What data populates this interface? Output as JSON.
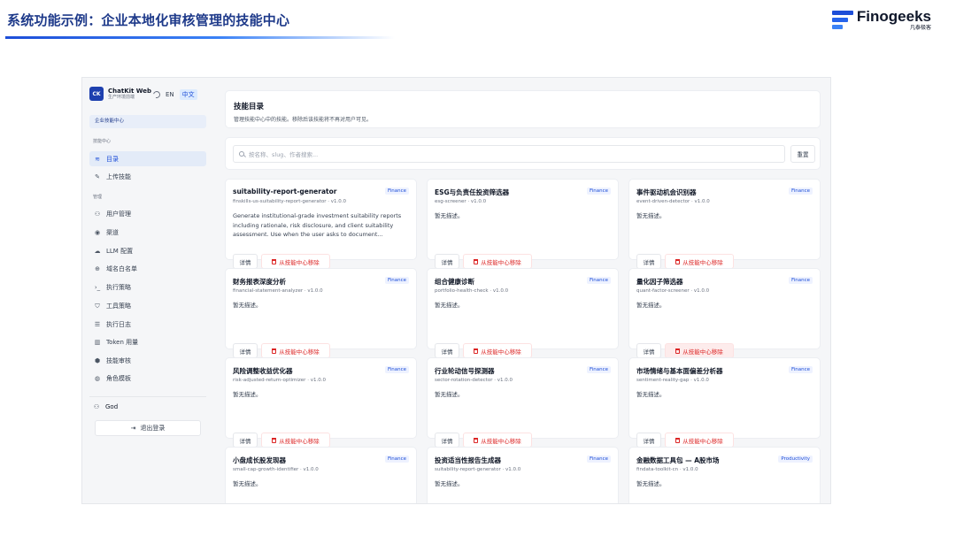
{
  "slide": {
    "title": "系统功能示例：企业本地化审核管理的技能中心",
    "brand": {
      "name": "Finogeeks",
      "sub": "凡泰极客"
    }
  },
  "sidebar": {
    "app_name": "ChatKit Web",
    "app_sub": "生产环境前端",
    "lang_en": "EN",
    "lang_zh": "中文",
    "enterprise_chip": "企业技能中心",
    "section_skills": "技能中心",
    "section_manage": "管理",
    "skills_items": [
      {
        "label": "目录",
        "icon": "layers-icon",
        "glyph": "≋"
      },
      {
        "label": "上传技能",
        "icon": "edit-icon",
        "glyph": "✎"
      }
    ],
    "manage_items": [
      {
        "label": "用户管理",
        "icon": "users-icon",
        "glyph": "⚇"
      },
      {
        "label": "渠道",
        "icon": "radio-icon",
        "glyph": "◉"
      },
      {
        "label": "LLM 配置",
        "icon": "cloud-icon",
        "glyph": "☁"
      },
      {
        "label": "域名白名单",
        "icon": "globe-icon",
        "glyph": "⊕"
      },
      {
        "label": "执行策略",
        "icon": "terminal-icon",
        "glyph": "›_"
      },
      {
        "label": "工具策略",
        "icon": "shield-icon",
        "glyph": "⛉"
      },
      {
        "label": "执行日志",
        "icon": "list-icon",
        "glyph": "☰"
      },
      {
        "label": "Token 用量",
        "icon": "bar-chart-icon",
        "glyph": "▥"
      },
      {
        "label": "技能审核",
        "icon": "package-icon",
        "glyph": "⬢"
      },
      {
        "label": "角色模板",
        "icon": "palette-icon",
        "glyph": "◍"
      }
    ],
    "user": "God",
    "logout": "退出登录"
  },
  "main": {
    "title": "技能目录",
    "description": "管理技能中心中的技能。移除后该技能将不再对用户可见。",
    "search_placeholder": "按名称、slug、作者搜索...",
    "reset": "重置",
    "detail_label": "详情",
    "remove_label": "从技能中心移除",
    "skills": [
      {
        "name": "suitability-report-generator",
        "tag": "Finance",
        "slug": "finskills-us-suitability-report-generator · v1.0.0",
        "desc": "Generate institutional-grade investment suitability reports including rationale, risk disclosure, and client suitability assessment. Use when the user asks to document..."
      },
      {
        "name": "ESG与负责任投资筛选器",
        "tag": "Finance",
        "slug": "esg-screener · v1.0.0",
        "desc": "暂无描述。"
      },
      {
        "name": "事件驱动机会识别器",
        "tag": "Finance",
        "slug": "event-driven-detector · v1.0.0",
        "desc": "暂无描述。"
      },
      {
        "name": "财务报表深度分析",
        "tag": "Finance",
        "slug": "financial-statement-analyzer · v1.0.0",
        "desc": "暂无描述。"
      },
      {
        "name": "组合健康诊断",
        "tag": "Finance",
        "slug": "portfolio-health-check · v1.0.0",
        "desc": "暂无描述。"
      },
      {
        "name": "量化因子筛选器",
        "tag": "Finance",
        "slug": "quant-factor-screener · v1.0.0",
        "desc": "暂无描述。"
      },
      {
        "name": "风险调整收益优化器",
        "tag": "Finance",
        "slug": "risk-adjusted-return-optimizer · v1.0.0",
        "desc": "暂无描述。"
      },
      {
        "name": "行业轮动信号探测器",
        "tag": "Finance",
        "slug": "sector-rotation-detector · v1.0.0",
        "desc": "暂无描述。"
      },
      {
        "name": "市场情绪与基本面偏差分析器",
        "tag": "Finance",
        "slug": "sentiment-reality-gap · v1.0.0",
        "desc": "暂无描述。"
      },
      {
        "name": "小盘成长股发现器",
        "tag": "Finance",
        "slug": "small-cap-growth-identifier · v1.0.0",
        "desc": "暂无描述。"
      },
      {
        "name": "投资适当性报告生成器",
        "tag": "Finance",
        "slug": "suitability-report-generator · v1.0.0",
        "desc": "暂无描述。"
      },
      {
        "name": "金融数据工具包 — A股市场",
        "tag": "Productivity",
        "slug": "findata-toolkit-cn · v1.0.0",
        "desc": "暂无描述。"
      }
    ]
  }
}
